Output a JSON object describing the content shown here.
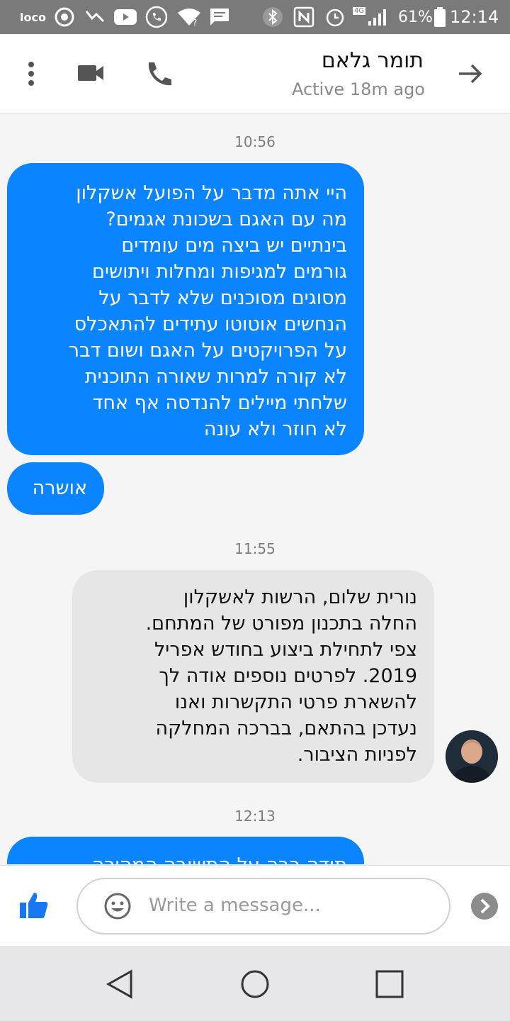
{
  "status_bar": {
    "carrier_label": "loco",
    "network_label": "4G",
    "battery_percent": "61%",
    "time": "12:14",
    "icons": [
      "chrome-icon",
      "check-icon",
      "youtube-icon",
      "phone-call-icon",
      "wifi-icon",
      "message-icon",
      "bluetooth-icon",
      "nfc-icon",
      "alarm-icon",
      "signal-icon",
      "battery-icon"
    ]
  },
  "header": {
    "contact_name": "תומר גלאם",
    "contact_status": "Active 18m ago",
    "icons": [
      "more-vert-icon",
      "video-call-icon",
      "phone-icon",
      "forward-arrow-icon"
    ]
  },
  "messages": {
    "timestamp_1": "10:56",
    "out_1": {
      "lines": [
        "היי אתה מדבר על הפועל אשקלון",
        "מה עם האגם בשכונת אגמים?",
        "בינתיים יש ביצה מים עומדים",
        "גורמים למגיפות ומחלות ויתושים",
        "מסוגים מסוכנים שלא לדבר על",
        "הנחשים אוטוטו עתידים להתאכלס",
        "על הפרויקטים על האגם ושום דבר",
        "לא קורה למרות שאורה התוכנית",
        "שלחתי מיילים להנדסה אף אחד",
        "לא חוזר ולא עונה"
      ]
    },
    "out_2": {
      "text": "אושרה"
    },
    "timestamp_2": "11:55",
    "in_1": {
      "lines": [
        "נורית שלום, הרשות לאשקלון",
        "החלה בתכנון מפורט של המתחם.",
        "צפי לתחילת ביצוע בחודש אפריל",
        "2019. לפרטים נוספים אודה לך",
        "להשארת פרטי התקשרות ואנו",
        "נעדכן בהתאם, בברכה המחלקה",
        "לפניות הציבור."
      ]
    },
    "timestamp_3": "12:13",
    "out_3": {
      "text": "תודה רבה על התשובה המהירה"
    }
  },
  "composer": {
    "placeholder": "Write a message...",
    "icons": [
      "like-icon",
      "emoji-icon",
      "send-icon"
    ]
  },
  "colors": {
    "outgoing_bubble": "#0a84ff",
    "incoming_bubble": "#e6e6e7",
    "like_button": "#1877f2"
  }
}
